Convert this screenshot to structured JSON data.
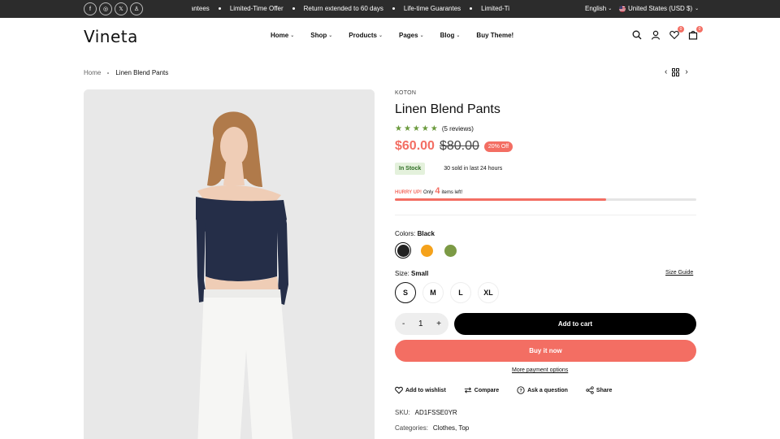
{
  "topbar": {
    "socials": [
      {
        "icon": "facebook-icon",
        "glyph": "f"
      },
      {
        "icon": "instagram-icon",
        "glyph": "◎"
      },
      {
        "icon": "x-icon",
        "glyph": "𝕏"
      },
      {
        "icon": "snapchat-icon",
        "glyph": "♙"
      }
    ],
    "ticker": [
      "Guarantees",
      "Limited-Time Offer",
      "Return extended to 60 days",
      "Life-time Guarantes",
      "Limited-Ti"
    ],
    "language": "English",
    "currency": "United States (USD $)"
  },
  "header": {
    "logo": "Vineta",
    "nav": [
      {
        "label": "Home",
        "has_dropdown": true
      },
      {
        "label": "Shop",
        "has_dropdown": true
      },
      {
        "label": "Products",
        "has_dropdown": true
      },
      {
        "label": "Pages",
        "has_dropdown": true
      },
      {
        "label": "Blog",
        "has_dropdown": true
      },
      {
        "label": "Buy Theme!",
        "has_dropdown": false
      }
    ],
    "wishlist_count": "0",
    "cart_count": "0"
  },
  "breadcrumb": {
    "home": "Home",
    "current": "Linen Blend Pants"
  },
  "product": {
    "brand": "KOTON",
    "title": "Linen Blend Pants",
    "rating": 5,
    "reviews": "(5 reviews)",
    "price": "$60.00",
    "old_price": "$80.00",
    "discount": "20% Off",
    "stock": "In Stock",
    "sold": "30 sold in last 24 hours",
    "hurry": {
      "prefix": "HURRY UP!",
      "only": "Only",
      "count": "4",
      "suffix": "items left!"
    },
    "stock_progress": 0.7,
    "color_label": "Colors:",
    "color_selected": "Black",
    "colors": [
      {
        "name": "Black",
        "hex": "#222222",
        "active": true
      },
      {
        "name": "Orange",
        "hex": "#f5a21b",
        "active": false
      },
      {
        "name": "Green",
        "hex": "#7c9a45",
        "active": false
      }
    ],
    "size_label": "Size:",
    "size_selected": "Small",
    "size_guide": "Size Guide",
    "sizes": [
      {
        "label": "S",
        "active": true
      },
      {
        "label": "M",
        "active": false
      },
      {
        "label": "L",
        "active": false
      },
      {
        "label": "XL",
        "active": false
      }
    ],
    "quantity": "1",
    "qty_minus": "-",
    "qty_plus": "+",
    "add_to_cart": "Add to cart",
    "buy_now": "Buy it now",
    "more_payment": "More payment options",
    "actions": [
      {
        "label": "Add to wishlist",
        "icon": "heart-icon"
      },
      {
        "label": "Compare",
        "icon": "compare-icon"
      },
      {
        "label": "Ask a question",
        "icon": "question-icon"
      },
      {
        "label": "Share",
        "icon": "share-icon"
      }
    ],
    "sku_label": "SKU:",
    "sku": "AD1FSSE0YR",
    "categories_label": "Categories:",
    "categories": "Clothes, Top"
  }
}
